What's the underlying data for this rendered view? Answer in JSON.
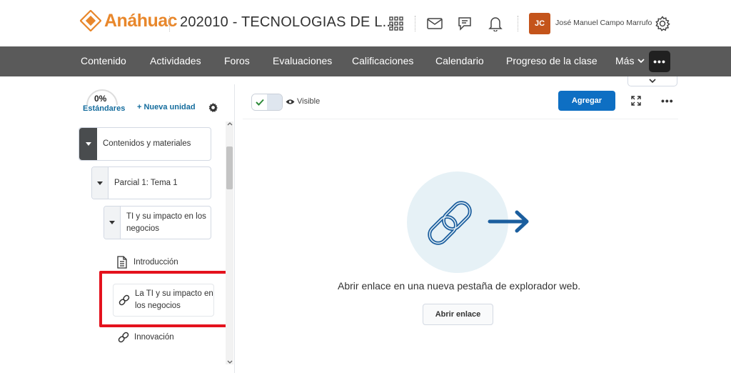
{
  "brand": {
    "logo_text": "Anáhuac",
    "accent": "#e8872b"
  },
  "header": {
    "course_title": "202010 - TECNOLOGIAS DE L...",
    "icons": [
      "apps-grid-icon",
      "mail-icon",
      "chat-icon",
      "bell-icon",
      "gear-icon"
    ],
    "avatar_initials": "JC",
    "user_name": "José Manuel Campo Marrufo"
  },
  "nav": {
    "items": [
      "Contenido",
      "Actividades",
      "Foros",
      "Evaluaciones",
      "Calificaciones",
      "Calendario",
      "Progreso de la clase"
    ],
    "more_label": "Más",
    "overflow_label": "•••"
  },
  "left_panel": {
    "progress_percent": "0%",
    "standards_label": "Estándares",
    "new_unit_label": "+ Nueva unidad",
    "tree": {
      "unit": "Contenidos y materiales",
      "lesson": "Parcial 1: Tema 1",
      "folder": "TI y su impacto en los negocios"
    },
    "topics": [
      "Introducción",
      "La TI y su impacto en los negocios",
      "Innovación"
    ]
  },
  "content": {
    "visibility_label": "Visible",
    "add_button": "Agregar",
    "overflow_label": "•••",
    "message": "Abrir enlace en una nueva pestaña de explorador web.",
    "open_link_button": "Abrir enlace"
  }
}
